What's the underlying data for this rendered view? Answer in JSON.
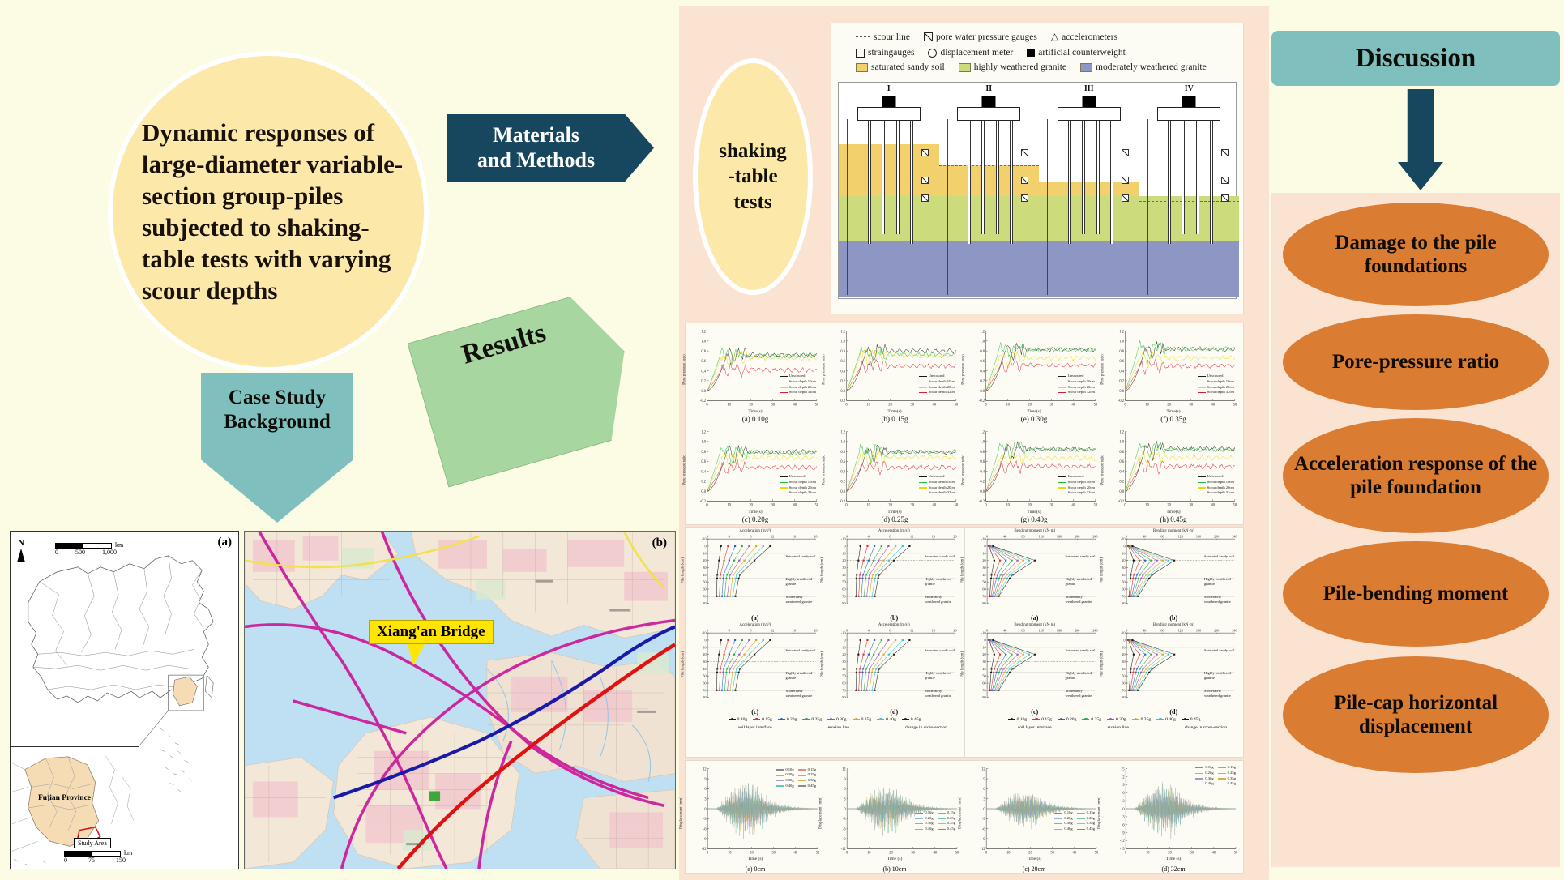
{
  "title": {
    "text": "Dynamic responses of large-diameter variable-section group-piles subjected to shaking-table tests with varying scour depths"
  },
  "flow": {
    "materials_methods": "Materials\nand Methods",
    "materials_methods_line1": "Materials",
    "materials_methods_line2": "and Methods",
    "results": "Results",
    "case_study": "Case Study\nBackground",
    "case_study_line1": "Case Study",
    "case_study_line2": "Background",
    "shaking_table": "shaking\n-table\ntests",
    "shaking_line1": "shaking",
    "shaking_line2": "-table",
    "shaking_line3": "tests"
  },
  "maps": {
    "panel_a_label": "(a)",
    "panel_b_label": "(b)",
    "north": "N",
    "scale_a": {
      "unit": "km",
      "ticks": [
        "0",
        "500",
        "1,000"
      ]
    },
    "scale_b": {
      "unit": "km",
      "ticks": [
        "0",
        "75",
        "150"
      ]
    },
    "fujian_label": "Fujian Province",
    "study_area_label": "Study Area",
    "bridge_label": "Xiang'an Bridge"
  },
  "schematic": {
    "legend": [
      {
        "sym": "scour-line-icon",
        "label": "scour line"
      },
      {
        "sym": "pore-water-pressure-gauge-icon",
        "label": "pore water pressure gauges"
      },
      {
        "sym": "accelerometer-icon",
        "label": "accelerometers"
      },
      {
        "sym": "straingauge-icon",
        "label": "straingauges"
      },
      {
        "sym": "displacement-meter-icon",
        "label": "displacement meter"
      },
      {
        "sym": "artificial-counterweight-icon",
        "label": "artificial counterweight"
      },
      {
        "sym": "saturated-sandy-soil-swatch",
        "label": "saturated sandy soil"
      },
      {
        "sym": "highly-weathered-granite-swatch",
        "label": "highly weathered granite"
      },
      {
        "sym": "moderately-weathered-granite-swatch",
        "label": "moderately weathered granite"
      }
    ],
    "models": [
      "I",
      "II",
      "III",
      "IV"
    ],
    "colors": {
      "saturated_sandy_soil": "#f2d06b",
      "highly_weathered_granite": "#ccdb7c",
      "moderately_weathered_granite": "#8e96c4"
    }
  },
  "chart_data": [
    {
      "type": "line",
      "id": "pore-pressure-ratio",
      "title": "Pore pressure ratio time histories",
      "xlabel": "Time(s)",
      "ylabel": "Pore pressure ratio",
      "xlim": [
        0,
        50
      ],
      "ylim": [
        -0.2,
        1.2
      ],
      "xticks": [
        0,
        10,
        20,
        30,
        40,
        50
      ],
      "yticks": [
        -0.2,
        0.0,
        0.2,
        0.4,
        0.6,
        0.8,
        1.0,
        1.2
      ],
      "legend": [
        "Unscoured",
        "Scour depth 10cm",
        "Scour depth 20cm",
        "Scour depth 32cm"
      ],
      "legend_colors": [
        "#1a1a1a",
        "#1fbf3f",
        "#e8d90c",
        "#d81a35"
      ],
      "panels": [
        {
          "caption": "(a) 0.10g",
          "plateau": [
            0.72,
            0.7,
            0.66,
            0.42
          ]
        },
        {
          "caption": "(b) 0.15g",
          "plateau": [
            0.8,
            0.73,
            0.7,
            0.5
          ]
        },
        {
          "caption": "(c) 0.20g",
          "plateau": [
            0.79,
            0.78,
            0.67,
            0.48
          ]
        },
        {
          "caption": "(d) 0.25g",
          "plateau": [
            0.79,
            0.79,
            0.68,
            0.48
          ]
        },
        {
          "caption": "(e) 0.30g",
          "plateau": [
            0.83,
            0.82,
            0.66,
            0.51
          ]
        },
        {
          "caption": "(f) 0.35g",
          "plateau": [
            0.84,
            0.84,
            0.66,
            0.5
          ]
        },
        {
          "caption": "(g) 0.40g",
          "plateau": [
            0.84,
            0.84,
            0.66,
            0.5
          ]
        },
        {
          "caption": "(h) 0.45g",
          "plateau": [
            0.85,
            0.84,
            0.67,
            0.5
          ]
        }
      ]
    },
    {
      "type": "line",
      "id": "acceleration-vs-pile-length",
      "title": "Acceleration response along pile",
      "xlabel": "Acceleration (m/s²)",
      "ylabel": "Pile length (cm)",
      "xlim": [
        0,
        20
      ],
      "ylim": [
        -10,
        80
      ],
      "xticks": [
        0,
        4,
        8,
        12,
        16,
        20
      ],
      "yticks": [
        -10,
        0,
        10,
        20,
        30,
        40,
        50,
        60,
        70,
        80
      ],
      "soil_labels": [
        "Saturated sandy soil",
        "Highly weathered granite",
        "Moderately weathered granite"
      ],
      "panels": [
        {
          "caption": "(a)"
        },
        {
          "caption": "(b)"
        },
        {
          "caption": "(c)"
        },
        {
          "caption": "(d)"
        }
      ],
      "legend_g": [
        "0.10g",
        "0.15g",
        "0.20g",
        "0.25g",
        "0.30g",
        "0.35g",
        "0.40g",
        "0.45g"
      ],
      "legend_g_colors": [
        "#1a1a1a",
        "#e03030",
        "#2a5fd6",
        "#2aa84a",
        "#9b4fc4",
        "#e0a020",
        "#28c8d6",
        "#1a1a1a"
      ],
      "legend_lines": [
        "soil layer interface",
        "erosion line",
        "change in cross-section"
      ]
    },
    {
      "type": "line",
      "id": "bending-moment-vs-pile-length",
      "title": "Pile bending moment",
      "xlabel": "Bending moment (kN·m)",
      "ylabel": "Pile length (cm)",
      "xlim": [
        0,
        240
      ],
      "ylim": [
        -10,
        80
      ],
      "xticks": [
        0,
        40,
        80,
        120,
        160,
        200,
        240
      ],
      "yticks": [
        -10,
        0,
        10,
        20,
        30,
        40,
        50,
        60,
        70,
        80
      ],
      "soil_labels": [
        "Saturated sandy soil",
        "Highly weathered granite",
        "Moderately weathered granite"
      ],
      "panels": [
        {
          "caption": "(a)"
        },
        {
          "caption": "(b)"
        },
        {
          "caption": "(c)"
        },
        {
          "caption": "(d)"
        }
      ],
      "legend_g": [
        "0.10g",
        "0.15g",
        "0.20g",
        "0.25g",
        "0.30g",
        "0.35g",
        "0.40g",
        "0.45g"
      ],
      "legend_lines": [
        "soil layer interface",
        "erosion line",
        "change in cross-section"
      ]
    },
    {
      "type": "line",
      "id": "pile-cap-displacement",
      "title": "Pile-cap horizontal displacement time histories",
      "xlabel": "Time (s)",
      "ylabel": "Displacement (mm)",
      "xlim": [
        0,
        50
      ],
      "xticks": [
        0,
        10,
        20,
        30,
        40,
        50
      ],
      "legend": [
        "0.10g",
        "0.15g",
        "0.20g",
        "0.25g",
        "0.30g",
        "0.35g",
        "0.40g",
        "0.45g"
      ],
      "legend_colors": [
        "#8a8a8a",
        "#d98a8a",
        "#8ab6d9",
        "#6fc6bd",
        "#a89ac6",
        "#d6b24a",
        "#5ec8c0",
        "#8a8a8a"
      ],
      "panels": [
        {
          "caption": "(a) 0cm",
          "ylim": [
            -12,
            12
          ],
          "yticks": [
            -12,
            -9,
            -6,
            -3,
            0,
            3,
            6,
            9,
            12
          ],
          "amp": 7.5
        },
        {
          "caption": "(b) 10cm",
          "ylim": [
            -12,
            12
          ],
          "yticks": [
            -12,
            -9,
            -6,
            -3,
            0,
            3,
            6,
            9,
            12
          ],
          "amp": 6.5
        },
        {
          "caption": "(c) 20cm",
          "ylim": [
            -12,
            12
          ],
          "yticks": [
            -12,
            -9,
            -6,
            -3,
            0,
            3,
            6,
            9,
            12
          ],
          "amp": 5.0
        },
        {
          "caption": "(d) 32cm",
          "ylim": [
            -15,
            15
          ],
          "yticks": [
            -15,
            -12,
            -9,
            -6,
            -3,
            0,
            3,
            6,
            9,
            12,
            15
          ],
          "amp": 9.0
        }
      ]
    }
  ],
  "discussion": {
    "header": "Discussion",
    "items": [
      "Damage to the pile foundations",
      "Pore-pressure ratio",
      "Acceleration response of the pile foundation",
      "Pile-bending moment",
      "Pile-cap horizontal displacement"
    ]
  },
  "colors": {
    "bg_cream": "#fcfbe4",
    "bg_peach": "#fbe3d2",
    "teal": "#7fc0bf",
    "dark_teal": "#17475f",
    "orange": "#db7c33",
    "yellow_circle": "#fce8a8",
    "green_results": "#a8d6a0",
    "callout_yellow": "#ffe500"
  }
}
